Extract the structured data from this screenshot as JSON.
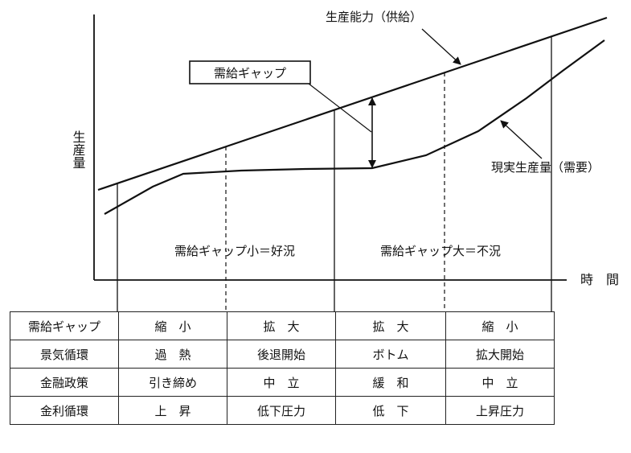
{
  "chart": {
    "supply_label": "生産能力（供給）",
    "demand_label": "現実生産量（需要）",
    "gap_box_label": "需給ギャップ",
    "y_axis_label": "生産量",
    "x_axis_label": "時　間",
    "region_small_gap": "需給ギャップ小＝好況",
    "region_large_gap": "需給ギャップ大＝不況"
  },
  "table": {
    "rows": [
      {
        "label": "需給ギャップ",
        "cells": [
          "縮　小",
          "拡　大",
          "拡　大",
          "縮　小"
        ]
      },
      {
        "label": "景気循環",
        "cells": [
          "過　熱",
          "後退開始",
          "ボトム",
          "拡大開始"
        ]
      },
      {
        "label": "金融政策",
        "cells": [
          "引き締め",
          "中　立",
          "緩　和",
          "中　立"
        ]
      },
      {
        "label": "金利循環",
        "cells": [
          "上　昇",
          "低下圧力",
          "低　下",
          "上昇圧力"
        ]
      }
    ]
  }
}
